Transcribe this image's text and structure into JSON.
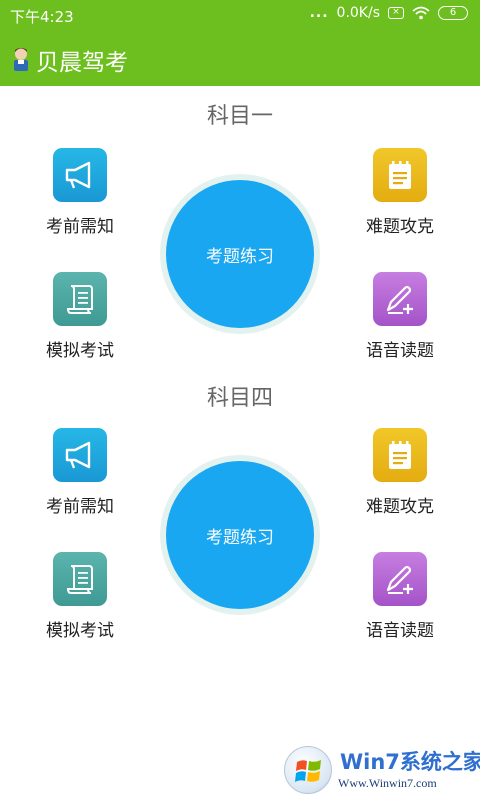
{
  "status_bar": {
    "time": "下午4:23",
    "dots": "...",
    "speed": "0.0K/s",
    "sim_icon": "x-sim-icon",
    "wifi_icon": "wifi-icon",
    "battery_level": "6"
  },
  "app_bar": {
    "title": "贝晨驾考",
    "logo_icon": "student-avatar-icon"
  },
  "sections": [
    {
      "title": "科目一",
      "practice_label": "考题练习",
      "items": [
        {
          "label": "考前需知",
          "icon": "megaphone-icon",
          "color": "#1fa9e0"
        },
        {
          "label": "难题攻克",
          "icon": "notepad-icon",
          "color": "#ebbb1e"
        },
        {
          "label": "模拟考试",
          "icon": "scroll-icon",
          "color": "#4ca8a2"
        },
        {
          "label": "语音读题",
          "icon": "pen-plus-icon",
          "color": "#b76ad6"
        }
      ]
    },
    {
      "title": "科目四",
      "practice_label": "考题练习",
      "items": [
        {
          "label": "考前需知",
          "icon": "megaphone-icon",
          "color": "#1fa9e0"
        },
        {
          "label": "难题攻克",
          "icon": "notepad-icon",
          "color": "#ebbb1e"
        },
        {
          "label": "模拟考试",
          "icon": "scroll-icon",
          "color": "#4ca8a2"
        },
        {
          "label": "语音读题",
          "icon": "pen-plus-icon",
          "color": "#b76ad6"
        }
      ]
    }
  ],
  "watermark": {
    "logo_icon": "windows-logo-icon",
    "text": "Win7系统之家",
    "url": "Www.Winwin7.com"
  },
  "colors": {
    "app_bar": "#6cbf1e",
    "practice_button": "#1aa7f2",
    "practice_ring": "#e4f2ef"
  }
}
